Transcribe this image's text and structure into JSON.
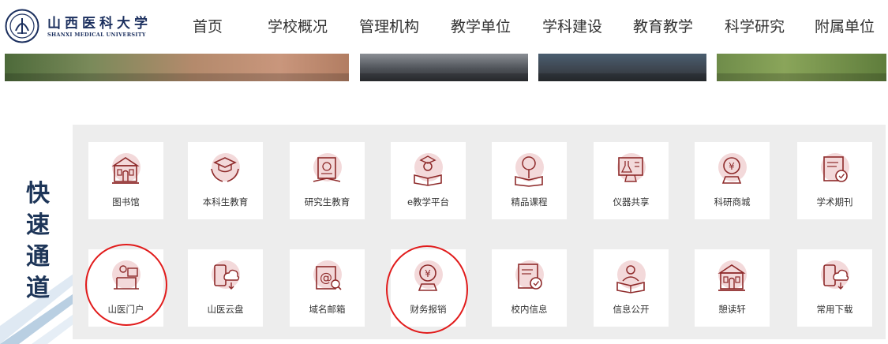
{
  "header": {
    "logo": {
      "name_cn": "山西医科大学",
      "name_en": "SHANXI MEDICAL UNIVERSITY"
    },
    "nav": [
      {
        "label": "首页"
      },
      {
        "label": "学校概况"
      },
      {
        "label": "管理机构"
      },
      {
        "label": "教学单位"
      },
      {
        "label": "学科建设"
      },
      {
        "label": "教育教学"
      },
      {
        "label": "科学研究"
      },
      {
        "label": "附属单位"
      }
    ]
  },
  "quick_access": {
    "title_chars": [
      "快",
      "速",
      "通",
      "道"
    ],
    "tiles": [
      {
        "label": "图书馆",
        "icon": "library-building-icon"
      },
      {
        "label": "本科生教育",
        "icon": "graduation-cap-hands-icon"
      },
      {
        "label": "研究生教育",
        "icon": "certificate-book-icon"
      },
      {
        "label": "e教学平台",
        "icon": "teacher-book-icon"
      },
      {
        "label": "精品课程",
        "icon": "open-book-tree-icon"
      },
      {
        "label": "仪器共享",
        "icon": "lab-flask-monitor-icon"
      },
      {
        "label": "科研商城",
        "icon": "crystal-ball-yen-icon"
      },
      {
        "label": "学术期刊",
        "icon": "journal-badge-icon"
      },
      {
        "label": "山医门户",
        "icon": "portal-desk-icon"
      },
      {
        "label": "山医云盘",
        "icon": "cloud-phone-icon"
      },
      {
        "label": "域名邮箱",
        "icon": "email-at-icon"
      },
      {
        "label": "财务报销",
        "icon": "finance-yen-icon"
      },
      {
        "label": "校内信息",
        "icon": "document-badge-icon"
      },
      {
        "label": "信息公开",
        "icon": "reader-book-icon"
      },
      {
        "label": "憩读轩",
        "icon": "reading-house-icon"
      },
      {
        "label": "常用下载",
        "icon": "download-phone-icon"
      }
    ]
  },
  "colors": {
    "accent": "#8e2a2a",
    "icon_bg": "#f3d9da",
    "title": "#1d3558",
    "annotation_circle": "#e11b1b"
  }
}
